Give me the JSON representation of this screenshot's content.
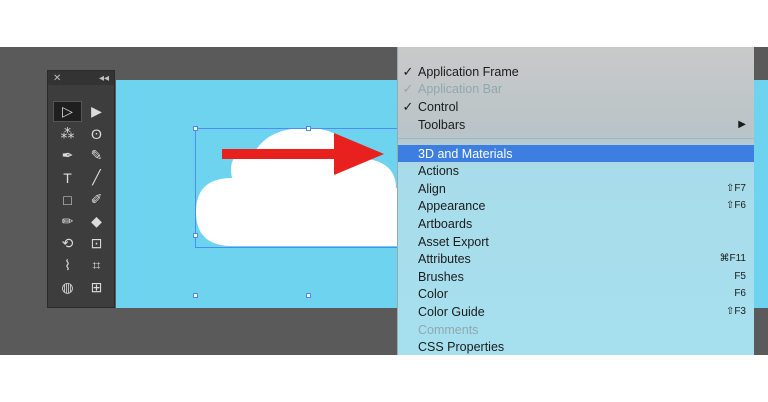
{
  "menu": {
    "items": [
      {
        "label": "Application Frame",
        "check": "✓",
        "shortcut": ""
      },
      {
        "label": "Application Bar",
        "check": "✓",
        "shortcut": ""
      },
      {
        "label": "Control",
        "check": "✓",
        "shortcut": ""
      },
      {
        "label": "Toolbars",
        "check": "",
        "shortcut": "▶"
      },
      {
        "label": "3D and Materials",
        "check": "",
        "shortcut": ""
      },
      {
        "label": "Actions",
        "check": "",
        "shortcut": ""
      },
      {
        "label": "Align",
        "check": "",
        "shortcut": "⇧F7"
      },
      {
        "label": "Appearance",
        "check": "",
        "shortcut": "⇧F6"
      },
      {
        "label": "Artboards",
        "check": "",
        "shortcut": ""
      },
      {
        "label": "Asset Export",
        "check": "",
        "shortcut": ""
      },
      {
        "label": "Attributes",
        "check": "",
        "shortcut": "⌘F11"
      },
      {
        "label": "Brushes",
        "check": "",
        "shortcut": "F5"
      },
      {
        "label": "Color",
        "check": "",
        "shortcut": "F6"
      },
      {
        "label": "Color Guide",
        "check": "",
        "shortcut": "⇧F3"
      },
      {
        "label": "Comments",
        "check": "",
        "shortcut": ""
      },
      {
        "label": "CSS Properties",
        "check": "",
        "shortcut": ""
      }
    ]
  },
  "tools_panel": {
    "close_glyph": "✕",
    "collapse_glyph": "◂◂",
    "tools": [
      {
        "icon": "direct-selection-icon",
        "glyph": "▷"
      },
      {
        "icon": "selection-icon",
        "glyph": "▶"
      },
      {
        "icon": "magic-wand-icon",
        "glyph": "⁂"
      },
      {
        "icon": "lasso-icon",
        "glyph": "ʘ"
      },
      {
        "icon": "pen-icon",
        "glyph": "✒"
      },
      {
        "icon": "curvature-icon",
        "glyph": "✎"
      },
      {
        "icon": "type-icon",
        "glyph": "T"
      },
      {
        "icon": "line-icon",
        "glyph": "╱"
      },
      {
        "icon": "rectangle-icon",
        "glyph": "□"
      },
      {
        "icon": "paintbrush-icon",
        "glyph": "✐"
      },
      {
        "icon": "pencil-icon",
        "glyph": "✏"
      },
      {
        "icon": "eraser-icon",
        "glyph": "◆"
      },
      {
        "icon": "rotate-icon",
        "glyph": "⟲"
      },
      {
        "icon": "scale-icon",
        "glyph": "⊡"
      },
      {
        "icon": "width-icon",
        "glyph": "⌇"
      },
      {
        "icon": "free-transform-icon",
        "glyph": "⌗"
      },
      {
        "icon": "shape-builder-icon",
        "glyph": "◍"
      },
      {
        "icon": "perspective-grid-icon",
        "glyph": "⊞"
      }
    ]
  },
  "colors": {
    "workspace": "#5a5a5a",
    "artboard": "#6dd3ef",
    "arrow": "#e8211e",
    "menu_highlight": "#3c7fe0",
    "selection": "#4c8cf5"
  }
}
